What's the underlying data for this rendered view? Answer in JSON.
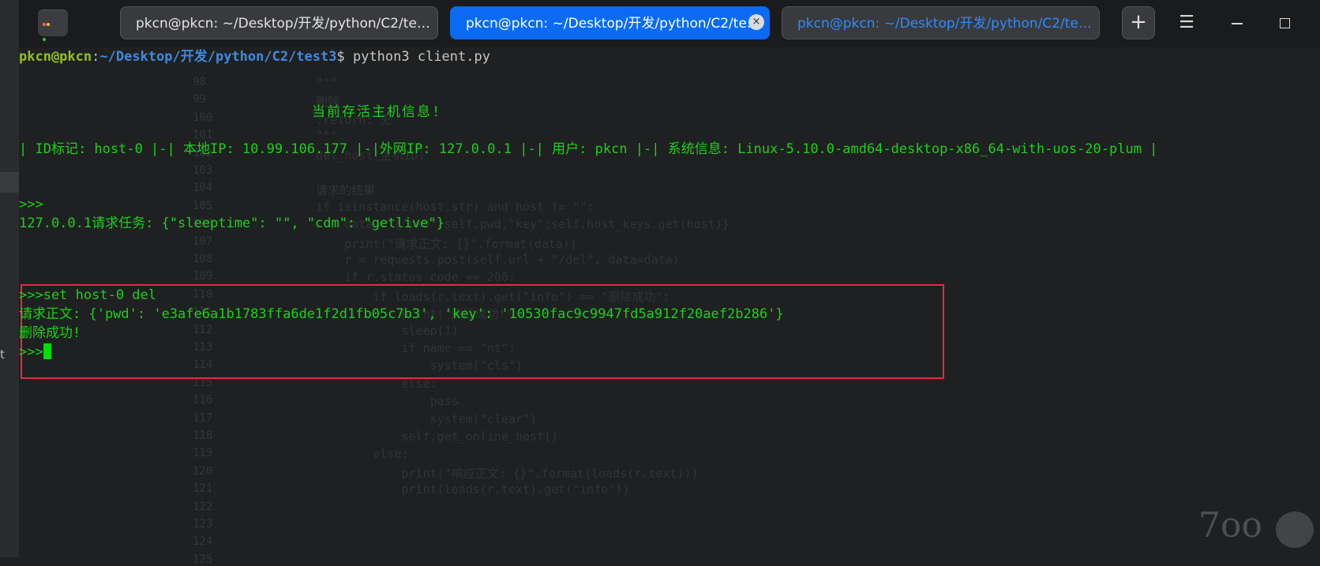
{
  "window": {
    "tabs": [
      {
        "label": "pkcn@pkcn: ~/Desktop/开发/python/C2/te…"
      },
      {
        "label": "pkcn@pkcn: ~/Desktop/开发/python/C2/te…"
      },
      {
        "label": "pkcn@pkcn: ~/Desktop/开发/python/C2/te…"
      }
    ],
    "tab_close_glyph": "×",
    "add_tab_glyph": "+",
    "menu_glyph": "☰",
    "close_glyph": "✕"
  },
  "sidebar": {
    "partial_label": "t"
  },
  "terminal": {
    "prompt_user": "pkcn@pkcn",
    "prompt_colon": ":",
    "prompt_path": "~/Desktop/开发/python/C2/test3",
    "prompt_dollar": "$",
    "command": " python3 client.py",
    "header": "当前存活主机信息!",
    "host_line": "| ID标记: host-0 |-| 本地IP: 10.99.106.177 |-|外网IP: 127.0.0.1 |-| 用户: pkcn |-| 系统信息: Linux-5.10.0-amd64-desktop-x86_64-with-uos-20-plum |",
    "prompt_empty": ">>>",
    "task_line": "127.0.0.1请求任务: {\"sleeptime\": \"\", \"cdm\": \"getlive\"}",
    "set_cmd": ">>>set host-0 del",
    "body_line": "请求正文: {'pwd': 'e3afe6a1b1783ffa6de1f2d1fb05c7b3', 'key': '10530fac9c9947fd5a912f20aef2b286'}",
    "delete_ok": "删除成功!",
    "final_prompt": ">>>"
  },
  "background_code": {
    "line_numbers": [
      "98",
      "99",
      "100",
      "101",
      "102",
      "103",
      "104",
      "105",
      "106",
      "107",
      "108",
      "109",
      "110",
      "111",
      "112",
      "113",
      "114",
      "115",
      "116",
      "117",
      "118",
      "119",
      "120",
      "121",
      "122",
      "123",
      "124",
      "125"
    ],
    "lines": [
      "    \"\"\"",
      "    删除",
      "    :return: 无",
      "    \"\"\"",
      "    del_host(主机ID)",
      "",
      "    请求的结果",
      "    if isinstance(host,str) and host != \"\":",
      "        data = {\"pwd\":self.pwd,\"key\":self.host_keys.get(host)}",
      "        print(\"请求正文: {}\".format(data))",
      "        r = requests.post(self.url + \"/del\", data=data)",
      "        if r.status_code == 200:",
      "            if loads(r.text).get(\"info\") == \"删除成功\":",
      "                print(\"删除成功!\")",
      "                sleep(1)",
      "                if name == \"nt\":",
      "                    system(\"cls\")",
      "                else:",
      "                    pass",
      "                    system(\"clear\")",
      "                self.get_online_host()",
      "            else:",
      "                print(\"响应正文: {}\".format(loads(r.text)))",
      "                print(loads(r.text).get(\"info\"))"
    ]
  },
  "watermark": {
    "text": "7oo"
  },
  "colors": {
    "terminal_green": "#19d219",
    "active_tab": "#0a6bf2",
    "highlight_box": "#e8283f"
  }
}
